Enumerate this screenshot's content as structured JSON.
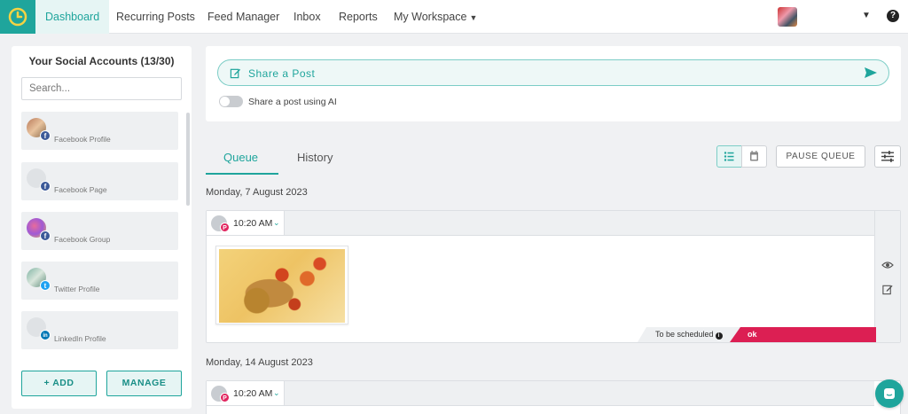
{
  "nav": {
    "items": [
      {
        "label": "Dashboard"
      },
      {
        "label": "Recurring Posts"
      },
      {
        "label": "Feed Manager"
      },
      {
        "label": "Inbox"
      },
      {
        "label": "Reports"
      },
      {
        "label": "My Workspace"
      }
    ],
    "active": "Dashboard",
    "help_glyph": "?"
  },
  "sidebar": {
    "title": "Your Social Accounts (13/30)",
    "search_placeholder": "Search...",
    "accounts": [
      {
        "label": "Facebook Profile",
        "badge": "f",
        "color": "#3b5998",
        "icon": "facebook-icon"
      },
      {
        "label": "Facebook Page",
        "badge": "f",
        "color": "#3b5998",
        "icon": "facebook-icon"
      },
      {
        "label": "Facebook Group",
        "badge": "f",
        "color": "#3b5998",
        "icon": "facebook-icon"
      },
      {
        "label": "Twitter Profile",
        "badge": "t",
        "color": "#1da1f2",
        "icon": "twitter-icon"
      },
      {
        "label": "LinkedIn Profile",
        "badge": "in",
        "color": "#0077b5",
        "icon": "linkedin-icon"
      }
    ],
    "add_label": "+ ADD",
    "manage_label": "MANAGE"
  },
  "share": {
    "label": "Share a Post",
    "ai_toggle_label": "Share a post using AI",
    "ai_toggle_on": false
  },
  "tabs": [
    {
      "label": "Queue"
    },
    {
      "label": "History"
    }
  ],
  "active_tab": "Queue",
  "queue_controls": {
    "pause_label": "PAUSE QUEUE"
  },
  "queue": [
    {
      "date": "Monday, 7 August 2023",
      "posts": [
        {
          "time": "10:20 AM",
          "network": "pinterest",
          "badge": "P",
          "status": "To be scheduled",
          "status_detail": "ok",
          "info_glyph": "i"
        }
      ]
    },
    {
      "date": "Monday, 14 August 2023",
      "posts": [
        {
          "time": "10:20 AM",
          "network": "pinterest",
          "badge": "P"
        }
      ]
    }
  ],
  "colors": {
    "accent": "#1fa59c",
    "status_red": "#dc1f53",
    "pinterest": "#e0245e"
  }
}
